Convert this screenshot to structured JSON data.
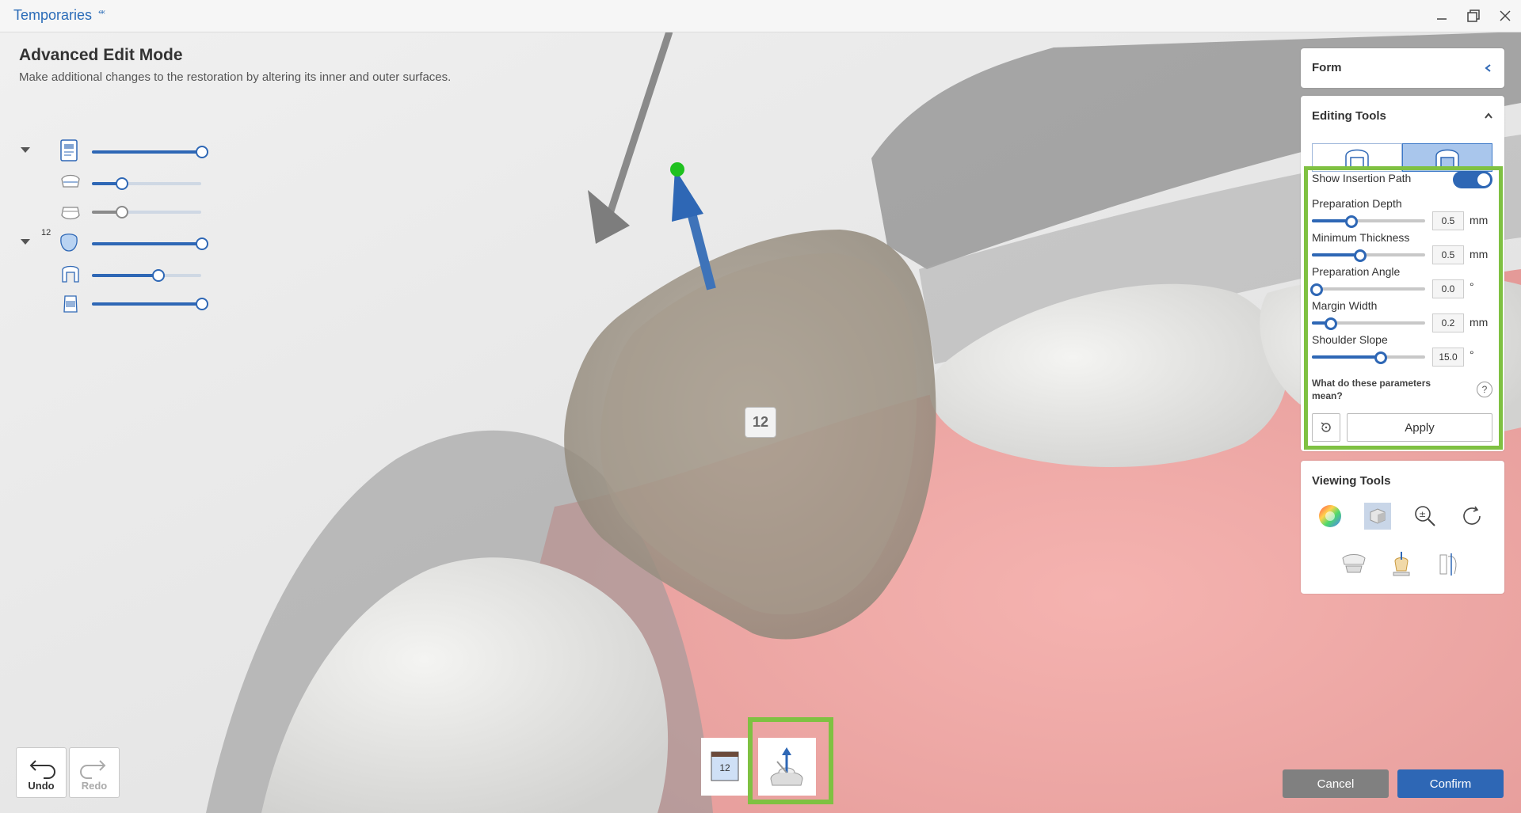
{
  "window": {
    "title": "Temporaries",
    "title_mark": "⬺"
  },
  "header": {
    "title": "Advanced Edit Mode",
    "description": "Make additional changes to the restoration by altering its inner and outer surfaces."
  },
  "layers": {
    "tooth_number": "12",
    "rows": [
      {
        "name": "scan-group",
        "opacity": 1.0
      },
      {
        "name": "upper-jaw",
        "opacity": 0.27
      },
      {
        "name": "lower-jaw",
        "opacity": 0.27
      },
      {
        "name": "tooth-12",
        "opacity": 1.0
      },
      {
        "name": "crown-inner",
        "opacity": 0.6
      },
      {
        "name": "die",
        "opacity": 1.0
      }
    ]
  },
  "viewport": {
    "tooth_label": "12"
  },
  "form_panel": {
    "title": "Form"
  },
  "editing_tools": {
    "title": "Editing Tools",
    "show_insertion_path_label": "Show Insertion Path",
    "show_insertion_path": true,
    "params": [
      {
        "label": "Preparation Depth",
        "value": "0.5",
        "unit": "mm",
        "level": 0.34
      },
      {
        "label": "Minimum Thickness",
        "value": "0.5",
        "unit": "mm",
        "level": 0.42
      },
      {
        "label": "Preparation Angle",
        "value": "0.0",
        "unit": "°",
        "level": 0.0
      },
      {
        "label": "Margin Width",
        "value": "0.2",
        "unit": "mm",
        "level": 0.16
      },
      {
        "label": "Shoulder Slope",
        "value": "15.0",
        "unit": "°",
        "level": 0.6
      }
    ],
    "help_text": "What do these parameters mean?",
    "help_icon": "?",
    "apply_label": "Apply"
  },
  "viewing_tools": {
    "title": "Viewing Tools"
  },
  "history": {
    "undo_label": "Undo",
    "redo_label": "Redo"
  },
  "bottom_tools": {
    "tooth_number": "12"
  },
  "actions": {
    "cancel_label": "Cancel",
    "confirm_label": "Confirm"
  },
  "colors": {
    "accent": "#2e67b5",
    "highlight": "#7fc142",
    "gum": "#f2a6a6",
    "crown": "#b8ada0"
  }
}
